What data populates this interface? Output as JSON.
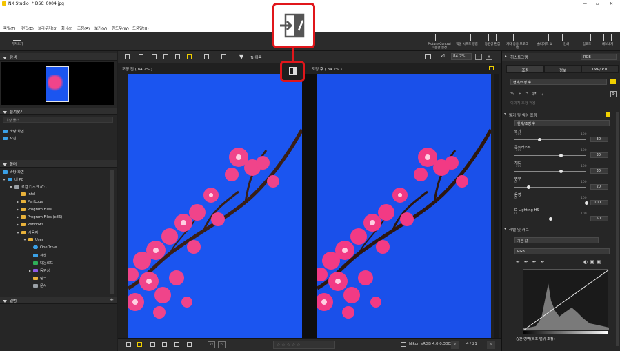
{
  "window": {
    "app_name": "NX Studio",
    "file_title": "* DSC_0004.jpg",
    "controls": [
      "—",
      "▫",
      "✕"
    ]
  },
  "menu": [
    "파일(F)",
    "편집(E)",
    "브라우저(B)",
    "화상(I)",
    "조정(A)",
    "보기(V)",
    "윈도우(W)",
    "도움말(H)"
  ],
  "toolbar": {
    "import_label": "가져오기",
    "tools": [
      {
        "label": "Picture Control 이용한 설정"
      },
      {
        "label": "픽셀 시프트 병합"
      },
      {
        "label": "동영상 편집"
      },
      {
        "label": "기타 응용 프로그램"
      },
      {
        "label": "슬라이드 쇼"
      },
      {
        "label": "인쇄"
      },
      {
        "label": "업로드"
      },
      {
        "label": "내보내기"
      }
    ]
  },
  "left_panel": {
    "navigator": "탐색",
    "favorites": "즐겨찾기",
    "favorites_placeholder": "대상 폴더",
    "favorites_items": [
      "바탕 화면",
      "사진"
    ],
    "folders": "폴더",
    "tree": [
      {
        "label": "바탕 화면",
        "level": 0
      },
      {
        "label": "내 PC",
        "level": 0
      },
      {
        "label": "로컬 디스크 (C:)",
        "level": 1
      },
      {
        "label": "Intel",
        "level": 2
      },
      {
        "label": "PerfLogs",
        "level": 2
      },
      {
        "label": "Program Files",
        "level": 2
      },
      {
        "label": "Program Files (x86)",
        "level": 2
      },
      {
        "label": "Windows",
        "level": 2
      },
      {
        "label": "사용자",
        "level": 2
      },
      {
        "label": "User",
        "level": 3
      },
      {
        "label": "OneDrive",
        "level": 4
      },
      {
        "label": "검색",
        "level": 4
      },
      {
        "label": "다운로드",
        "level": 4
      },
      {
        "label": "동영상",
        "level": 4
      },
      {
        "label": "링크",
        "level": 4
      },
      {
        "label": "문서",
        "level": 4
      }
    ],
    "albums": "앨범"
  },
  "viewer": {
    "sort_label": "이름",
    "zoom_value": "84.2%",
    "zoom_prefix": "x1",
    "left_pane_label": "조정 전 ( 84.2% )",
    "right_pane_label": "조정 후 ( 84.2% )"
  },
  "bottom": {
    "color_profile": "Nikon sRGB 4.0.0.3002",
    "page_counter": "4 / 21"
  },
  "right_panel": {
    "histogram": "히스토그램",
    "histogram_mode": "RGB",
    "tabs": [
      "조정",
      "정보",
      "XMP/IPTC"
    ],
    "preset": "현재/조정 후",
    "apply_preset": "이미지 조정 적용",
    "section_brightness": "밝기 및 색상 조정",
    "section_brightness_preset": "현재/조정 후",
    "sliders": [
      {
        "label": "밝기",
        "min": "-100",
        "max": "100",
        "value": "-30",
        "pos": 0.35
      },
      {
        "label": "콘트라스트",
        "min": "-100",
        "max": "100",
        "value": "30",
        "pos": 0.65
      },
      {
        "label": "채도",
        "min": "-100",
        "max": "100",
        "value": "30",
        "pos": 0.65
      },
      {
        "label": "명부",
        "min": "0",
        "max": "100",
        "value": "20",
        "pos": 0.2
      },
      {
        "label": "음영",
        "min": "0",
        "max": "100",
        "value": "100",
        "pos": 1.0
      },
      {
        "label": "D-Lighting HS",
        "min": "0",
        "max": "100",
        "value": "50",
        "pos": 0.5
      }
    ],
    "section_levels": "레벨 및 커브",
    "levels_preset": "기본 값",
    "levels_channel": "RGB",
    "levels_footer": "중간 영역(색조 범위 조정)"
  },
  "colors": {
    "accent_red": "#e0161b",
    "photo_sky": "#1b55f0",
    "blossom": "#f0448a"
  }
}
